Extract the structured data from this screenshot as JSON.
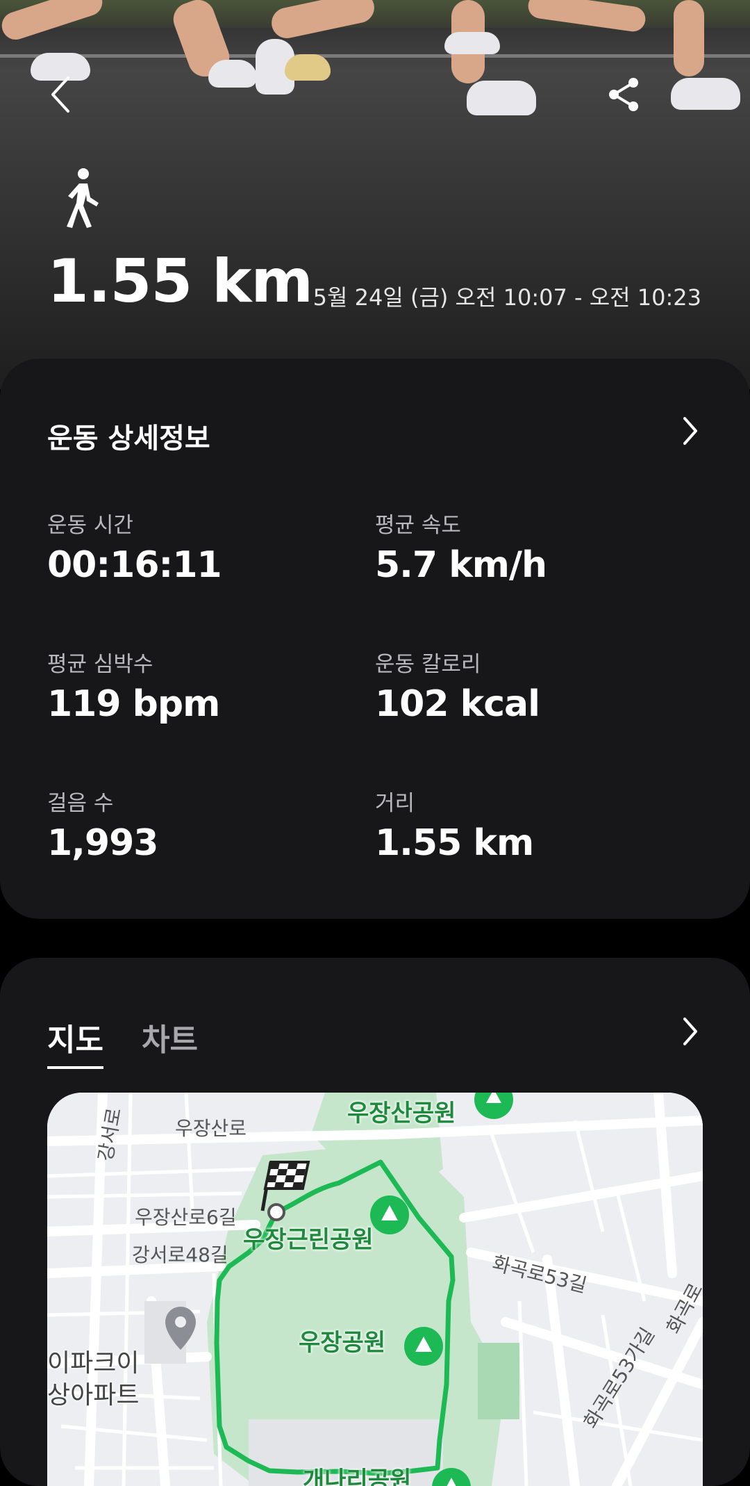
{
  "header": {
    "activity_icon": "walking-person-icon",
    "distance": "1.55 km",
    "time_range": "5월 24일 (금) 오전 10:07 - 오전 10:23",
    "back_icon": "back-arrow-icon",
    "share_icon": "share-icon"
  },
  "details": {
    "title": "운동 상세정보",
    "stats": [
      {
        "label": "운동 시간",
        "value": "00:16:11"
      },
      {
        "label": "평균 속도",
        "value": "5.7 km/h"
      },
      {
        "label": "평균 심박수",
        "value": "119 bpm"
      },
      {
        "label": "운동 칼로리",
        "value": "102 kcal"
      },
      {
        "label": "걸음 수",
        "value": "1,993"
      },
      {
        "label": "거리",
        "value": "1.55 km"
      }
    ]
  },
  "map_section": {
    "tabs": [
      {
        "label": "지도",
        "active": true
      },
      {
        "label": "차트",
        "active": false
      }
    ],
    "labels": {
      "park_top": "우장산공원",
      "park_mid": "우장공원",
      "park_left": "우장근린공원",
      "park_bottom": "개나리공원",
      "road1": "우장산로",
      "road2": "강서로",
      "road3": "우장산로6길",
      "road4": "강서로48길",
      "road5": "화곡로53길",
      "road6": "화곡로53가길",
      "road7": "화곡로",
      "apt": "이파크이",
      "apt2": "상아파트"
    },
    "route_color": "#1db954"
  },
  "colors": {
    "card_bg": "#171719",
    "accent_green": "#1db954",
    "park_fill": "#c6e6cc"
  }
}
